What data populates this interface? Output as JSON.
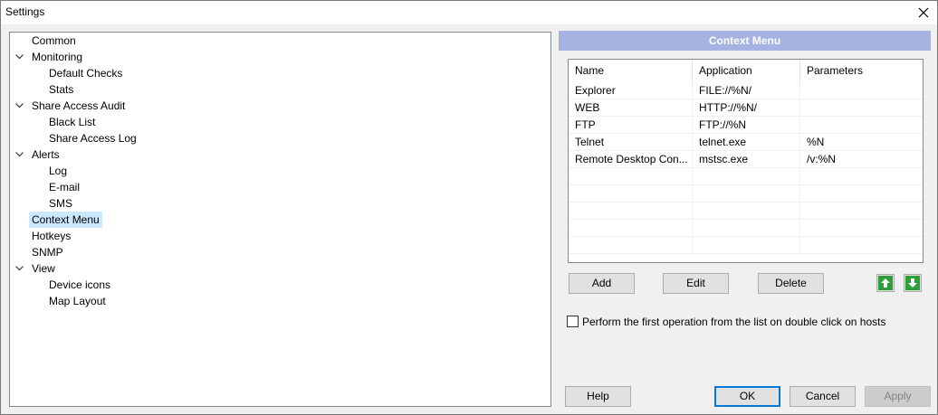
{
  "window": {
    "title": "Settings"
  },
  "tree": [
    {
      "label": "Common",
      "level": 0,
      "expandable": false
    },
    {
      "label": "Monitoring",
      "level": 0,
      "expandable": true
    },
    {
      "label": "Default Checks",
      "level": 1,
      "expandable": false
    },
    {
      "label": "Stats",
      "level": 1,
      "expandable": false
    },
    {
      "label": "Share Access Audit",
      "level": 0,
      "expandable": true
    },
    {
      "label": "Black List",
      "level": 1,
      "expandable": false
    },
    {
      "label": "Share Access Log",
      "level": 1,
      "expandable": false
    },
    {
      "label": "Alerts",
      "level": 0,
      "expandable": true
    },
    {
      "label": "Log",
      "level": 1,
      "expandable": false
    },
    {
      "label": "E-mail",
      "level": 1,
      "expandable": false
    },
    {
      "label": "SMS",
      "level": 1,
      "expandable": false
    },
    {
      "label": "Context Menu",
      "level": 0,
      "expandable": false,
      "selected": true
    },
    {
      "label": "Hotkeys",
      "level": 0,
      "expandable": false
    },
    {
      "label": "SNMP",
      "level": 0,
      "expandable": false
    },
    {
      "label": "View",
      "level": 0,
      "expandable": true
    },
    {
      "label": "Device icons",
      "level": 1,
      "expandable": false
    },
    {
      "label": "Map Layout",
      "level": 1,
      "expandable": false
    }
  ],
  "panel": {
    "title": "Context Menu",
    "columns": [
      "Name",
      "Application",
      "Parameters"
    ],
    "rows": [
      [
        "Explorer",
        "FILE://%N/",
        ""
      ],
      [
        "WEB",
        "HTTP://%N/",
        ""
      ],
      [
        "FTP",
        "FTP://%N",
        ""
      ],
      [
        "Telnet",
        "telnet.exe",
        "%N"
      ],
      [
        "Remote Desktop Con...",
        "mstsc.exe",
        "/v:%N"
      ]
    ],
    "empty_rows": 5,
    "buttons": {
      "add": "Add",
      "edit": "Edit",
      "delete": "Delete"
    },
    "move_up_icon": "arrow-up-icon",
    "move_down_icon": "arrow-down-icon",
    "accent_green": "#2e9e3a",
    "header_color": "#a6b2e2",
    "double_click_option": {
      "label": "Perform the first operation from the list on double click on hosts",
      "checked": false
    }
  },
  "footer": {
    "help": "Help",
    "ok": "OK",
    "cancel": "Cancel",
    "apply": "Apply"
  }
}
